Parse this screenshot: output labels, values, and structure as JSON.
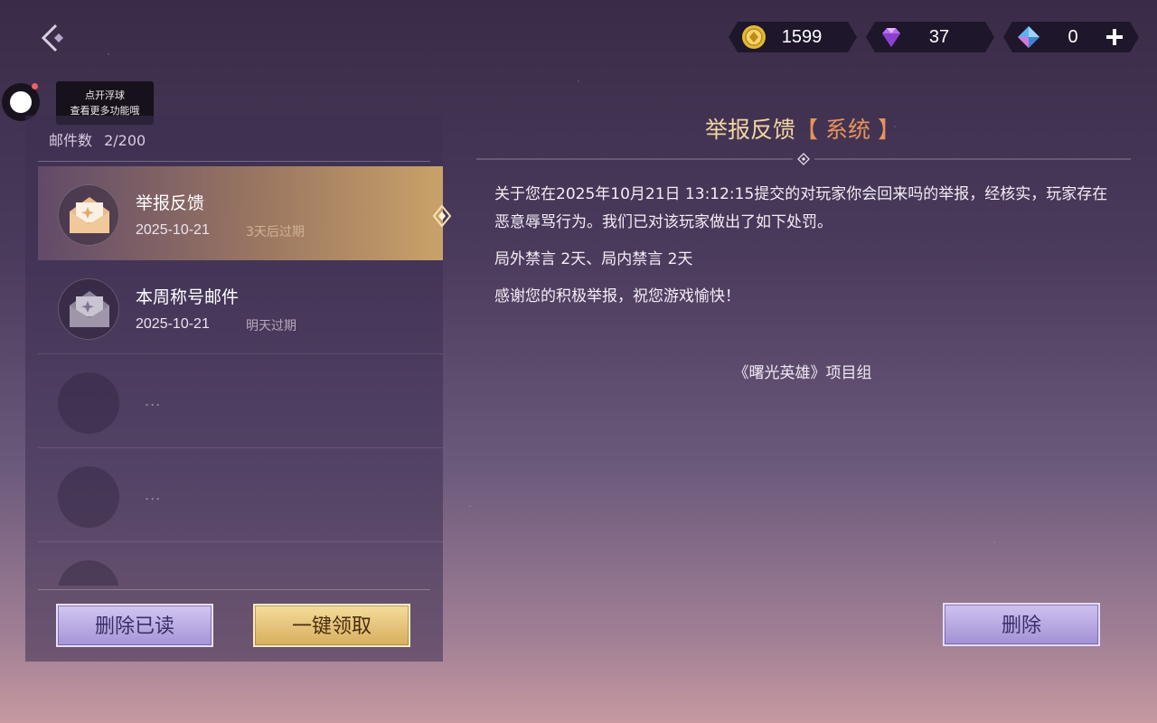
{
  "currencies": [
    {
      "name": "gold-coin",
      "icon": "gold-coin-icon",
      "value": "1599",
      "color": "#e0b93a"
    },
    {
      "name": "purple-diamond",
      "icon": "purple-diamond-icon",
      "value": "37",
      "color": "#b86bf0"
    },
    {
      "name": "blue-crystal",
      "icon": "blue-crystal-icon",
      "value": "0",
      "color": "#5fb0f2"
    }
  ],
  "float_tooltip": {
    "line1": "点开浮球",
    "line2": "查看更多功能哦"
  },
  "mailbox": {
    "count_label": "邮件数",
    "count_value": "2/200",
    "items": [
      {
        "subject": "举报反馈",
        "date": "2025-10-21",
        "expiry": "3天后过期",
        "selected": true
      },
      {
        "subject": "本周称号邮件",
        "date": "2025-10-21",
        "expiry": "明天过期",
        "selected": false
      },
      {
        "placeholder": "..."
      },
      {
        "placeholder": "..."
      }
    ],
    "delete_read_label": "删除已读",
    "claim_all_label": "一键领取"
  },
  "detail": {
    "title": "举报反馈",
    "tag": "【 系统 】",
    "paragraphs": [
      "关于您在2025年10月21日 13:12:15提交的对玩家你会回来吗的举报，经核实，玩家存在恶意辱骂行为。我们已对该玩家做出了如下处罚。",
      "局外禁言 2天、局内禁言 2天",
      "感谢您的积极举报，祝您游戏愉快！"
    ],
    "signature": "《曙光英雄》项目组",
    "delete_label": "删除"
  },
  "accent_colors": {
    "gold": "#d9b06a",
    "title": "#f2d6a2",
    "tag": "#e8935a",
    "button_purple": "#a594d6"
  }
}
